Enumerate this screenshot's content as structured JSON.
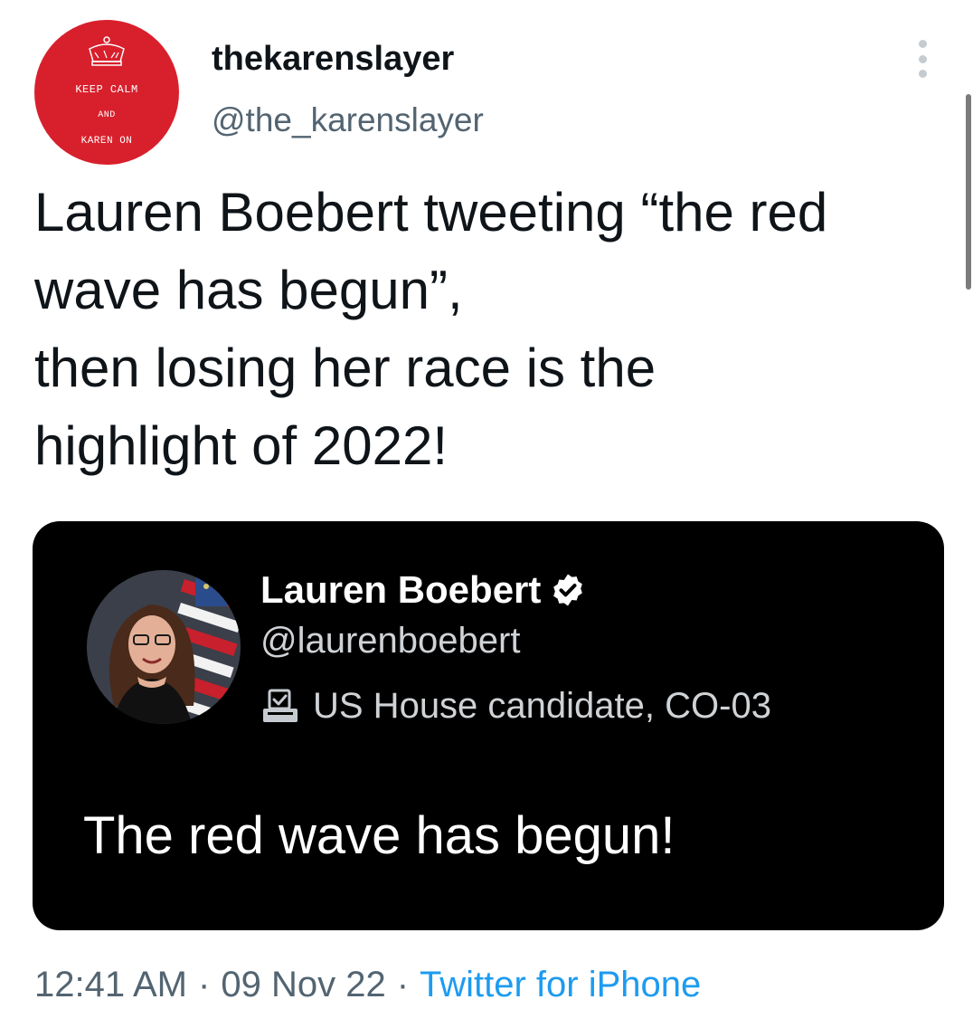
{
  "author": {
    "display_name": "thekarenslayer",
    "handle": "@the_karenslayer",
    "avatar_text": {
      "line1": "KEEP CALM",
      "line2": "AND",
      "line3": "KAREN ON"
    },
    "avatar_color": "#d8202c"
  },
  "tweet": {
    "lines": [
      "Lauren Boebert tweeting “the red",
      "wave has begun”,",
      "then losing her race is the",
      "highlight of 2022!"
    ]
  },
  "media": {
    "name": "Lauren Boebert",
    "handle": "@laurenboebert",
    "label": "US House candidate, CO-03",
    "text": "The red wave has begun!",
    "background": "#000000"
  },
  "meta": {
    "time": "12:41 AM",
    "date": "09 Nov 22",
    "separator": "·",
    "source": "Twitter for iPhone"
  },
  "colors": {
    "text_primary": "#0f1419",
    "text_secondary": "#536471",
    "link": "#1d9bf0",
    "verified": "#ffffff"
  }
}
